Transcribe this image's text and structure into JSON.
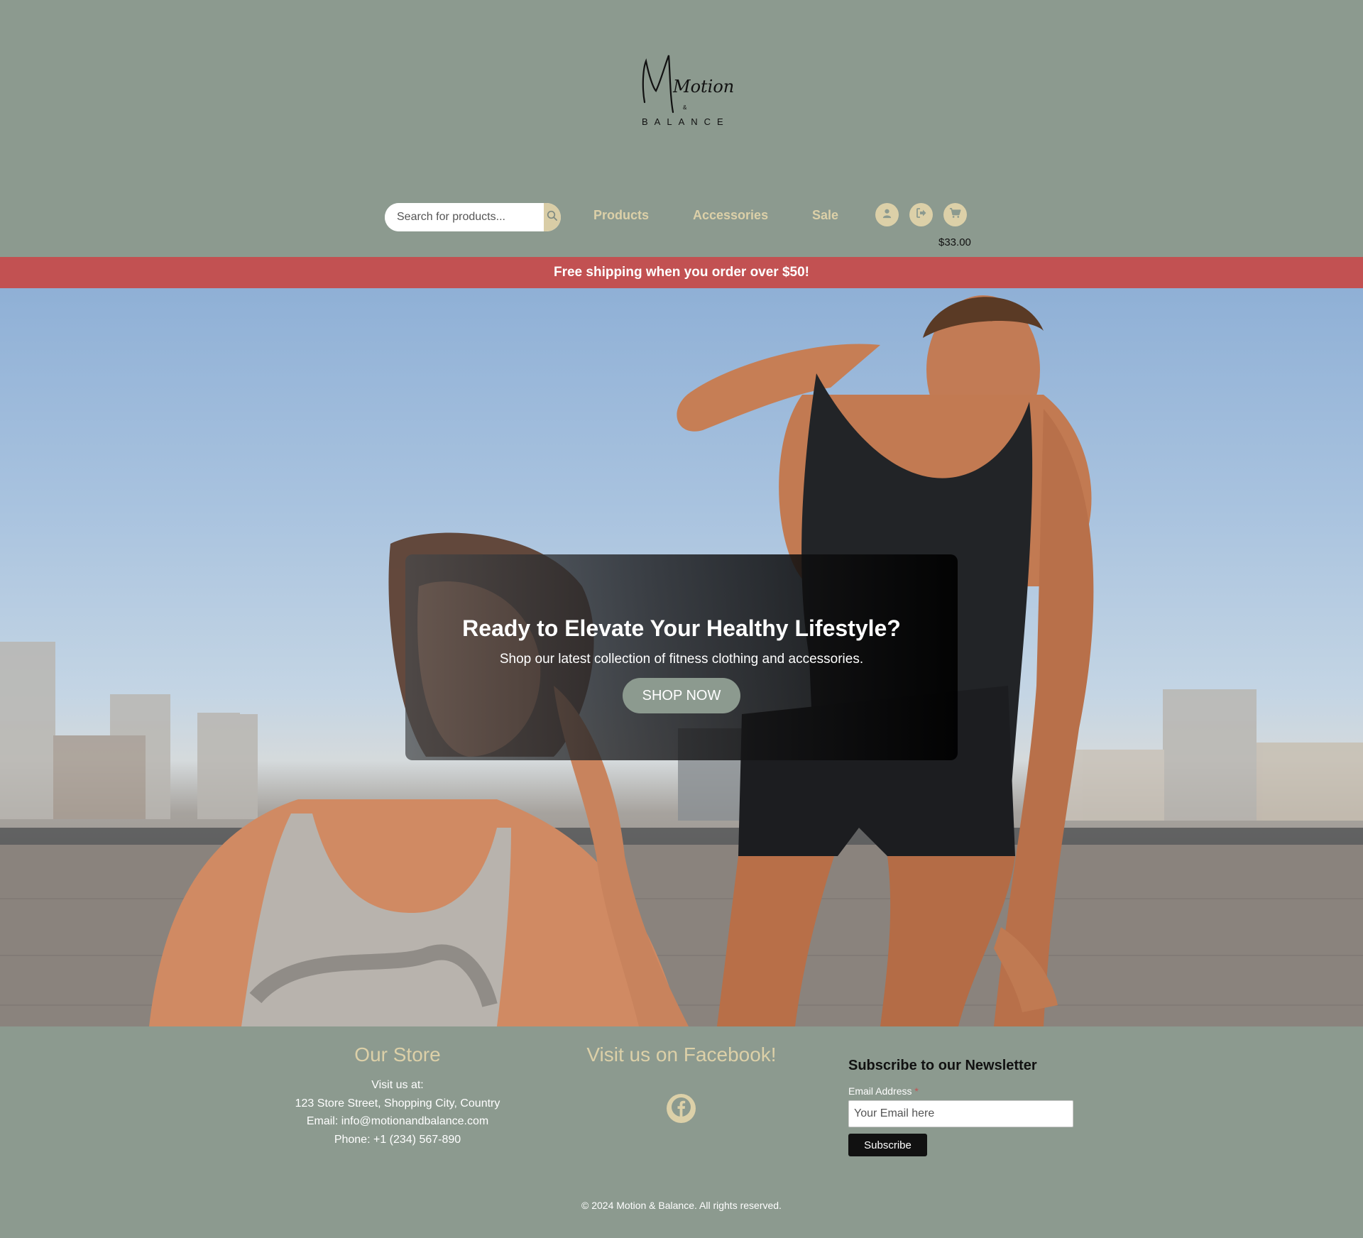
{
  "header": {
    "logo": {
      "script_text": "Motion",
      "ampersand": "&",
      "wordmark": "BALANCE"
    },
    "search": {
      "placeholder": "Search for products...",
      "button_icon": "search-icon"
    },
    "nav": {
      "products": "Products",
      "accessories": "Accessories",
      "sale": "Sale"
    },
    "icons": {
      "account": "user-icon",
      "logout": "logout-icon",
      "cart": "cart-icon"
    },
    "cart_total": "$33.00"
  },
  "banner": {
    "text": "Free shipping when you order over $50!"
  },
  "hero": {
    "heading": "Ready to Elevate Your Healthy Lifestyle?",
    "subheading": "Shop our latest collection of fitness clothing and accessories.",
    "cta": "SHOP NOW"
  },
  "footer": {
    "store": {
      "title": "Our Store",
      "visit": "Visit us at:",
      "address": "123 Store Street, Shopping City, Country",
      "email": "Email: info@motionandbalance.com",
      "phone": "Phone: +1 (234) 567-890"
    },
    "facebook": {
      "title": "Visit us on Facebook!",
      "icon": "facebook-icon"
    },
    "newsletter": {
      "title": "Subscribe to our Newsletter",
      "email_label": "Email Address",
      "required_mark": "*",
      "email_placeholder": "Your Email here",
      "button": "Subscribe"
    },
    "copyright": "© 2024 Motion & Balance. All rights reserved."
  },
  "colors": {
    "background": "#8c9a8f",
    "accent_gold": "#dcd0a8",
    "banner_red": "#c25152",
    "text_dark": "#111111"
  }
}
